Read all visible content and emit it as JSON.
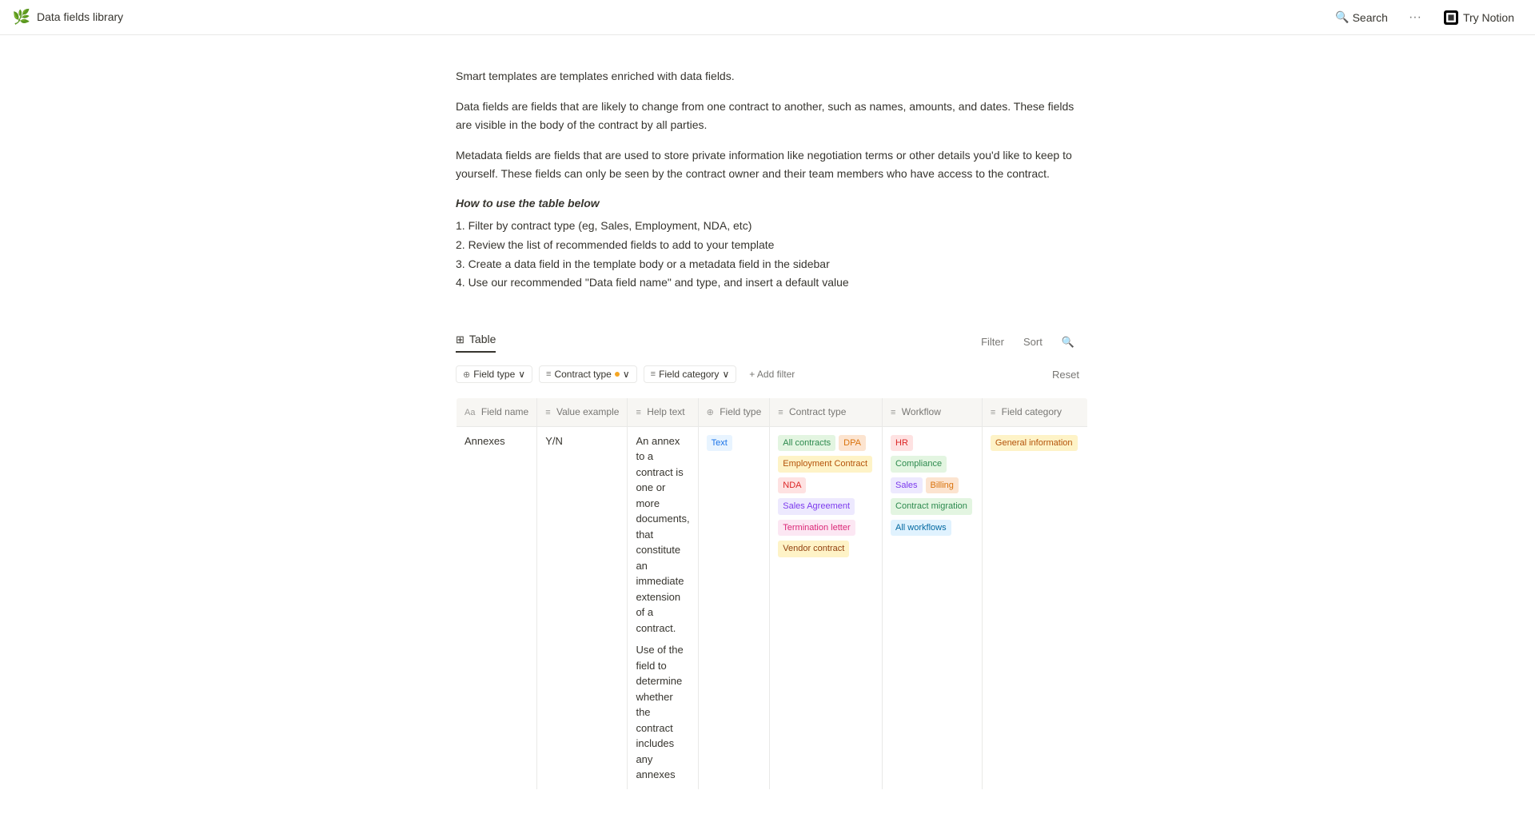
{
  "topbar": {
    "page_icon": "🌿",
    "page_title": "Data fields library",
    "search_label": "Search",
    "more_label": "···",
    "try_notion_label": "Try Notion"
  },
  "content": {
    "para1": "Smart templates are templates enriched with data fields.",
    "para2": "Data fields are fields that are likely to change from one contract to another, such as names, amounts, and dates. These fields are visible in the body of the contract by all parties.",
    "para3": "Metadata fields are fields that are used to store private information like negotiation terms or other details you'd like to keep to yourself. These fields can only be seen by the contract owner and their team members who have access to the contract.",
    "how_to_use_title": "How to use the table below",
    "steps": [
      "1. Filter by contract type (eg, Sales, Employment, NDA, etc)",
      "2. Review the list of recommended fields to add to your template",
      "3. Create a data field in the template body or a metadata field in the sidebar",
      "4. Use our recommended \"Data field name\" and type, and insert a default value"
    ]
  },
  "table": {
    "label": "Table",
    "filter_btn": "Filter",
    "sort_btn": "Sort",
    "search_icon": "🔍",
    "filter_chips": [
      {
        "icon": "⊕",
        "label": "Field type",
        "arrow": "∨"
      },
      {
        "icon": "≡",
        "label": "Contract type",
        "dot": true,
        "arrow": "∨"
      },
      {
        "icon": "≡",
        "label": "Field category",
        "arrow": "∨"
      }
    ],
    "add_filter_label": "+ Add filter",
    "reset_label": "Reset",
    "columns": [
      {
        "icon": "Aa",
        "label": "Field name"
      },
      {
        "icon": "≡",
        "label": "Value example"
      },
      {
        "icon": "≡",
        "label": "Help text"
      },
      {
        "icon": "⊕",
        "label": "Field type"
      },
      {
        "icon": "≡",
        "label": "Contract type"
      },
      {
        "icon": "≡",
        "label": "Workflow"
      },
      {
        "icon": "≡",
        "label": "Field category"
      }
    ],
    "rows": [
      {
        "field_name": "Annexes",
        "value_example": "Y/N",
        "help_text_1": "An annex to a contract is one or more documents, that constitute an immediate extension of a contract.",
        "help_text_2": "Use of the field to determine whether the contract includes any annexes",
        "field_type_tags": [
          {
            "label": "Text",
            "class": "tag-text"
          }
        ],
        "contract_type_tags": [
          {
            "label": "All contracts",
            "class": "tag-all-contracts"
          },
          {
            "label": "DPA",
            "class": "tag-dpa"
          },
          {
            "label": "Employment Contract",
            "class": "tag-employment"
          },
          {
            "label": "NDA",
            "class": "tag-nda"
          },
          {
            "label": "Sales Agreement",
            "class": "tag-sales-agreement"
          },
          {
            "label": "Termination letter",
            "class": "tag-termination"
          },
          {
            "label": "Vendor contract",
            "class": "tag-vendor"
          }
        ],
        "workflow_tags": [
          {
            "label": "HR",
            "class": "tag-hr"
          },
          {
            "label": "Compliance",
            "class": "tag-compliance"
          },
          {
            "label": "Sales",
            "class": "tag-sales"
          },
          {
            "label": "Billing",
            "class": "tag-billing"
          },
          {
            "label": "Contract migration",
            "class": "tag-contract-migration"
          },
          {
            "label": "All workflows",
            "class": "tag-all-workflows"
          }
        ],
        "field_category_tags": [
          {
            "label": "General information",
            "class": "tag-general-info"
          }
        ]
      }
    ]
  }
}
